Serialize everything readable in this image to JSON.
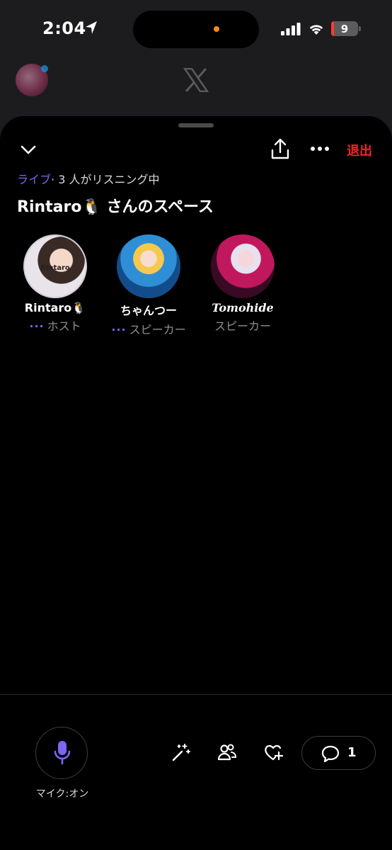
{
  "status_bar": {
    "time": "2:04",
    "battery": "9",
    "battery_level": 0.09
  },
  "space": {
    "live_label": "ライブ",
    "listening": "· 3 人がリスニング中",
    "title": "Rintaro🐧 さんのスペース",
    "leave_label": "退出",
    "speakers": [
      {
        "name": "Rintaro🐧",
        "role": "ホスト",
        "has_menu": true
      },
      {
        "name": "ちゃんつー",
        "role": "スピーカー",
        "has_menu": true
      },
      {
        "name": "Tomohide",
        "role": "スピーカー",
        "has_menu": false
      }
    ],
    "dots": "···"
  },
  "controls": {
    "mic_label": "マイク:オン",
    "comment_count": "1"
  },
  "colors": {
    "accent": "#7b67f5",
    "leave": "#f4212e",
    "background": "#000000"
  },
  "icons": [
    "location-arrow-icon",
    "signal-icon",
    "wifi-icon",
    "battery-icon",
    "x-logo-icon",
    "chevron-down-icon",
    "share-icon",
    "more-icon",
    "mic-icon",
    "magic-wand-icon",
    "people-icon",
    "heart-plus-icon",
    "comment-icon"
  ]
}
